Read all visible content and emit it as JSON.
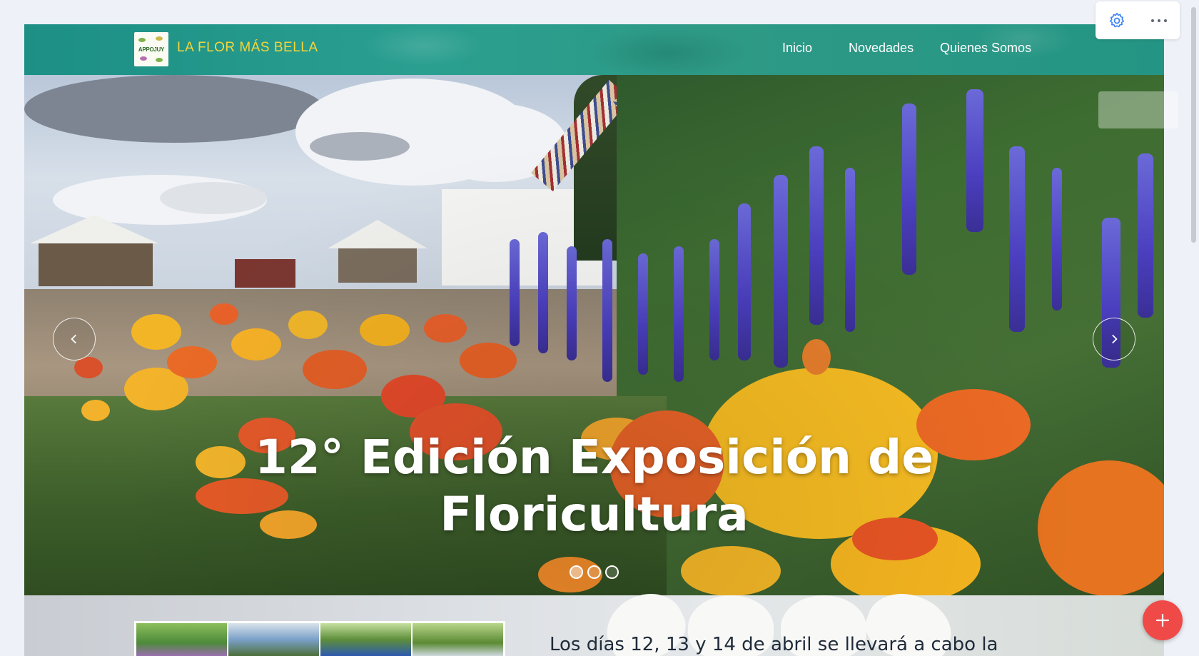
{
  "navbar": {
    "brand_logo_text": "APPOJUY",
    "brand_name": "LA FLOR MÁS BELLA",
    "links": [
      {
        "label": "Inicio"
      },
      {
        "label": "Novedades"
      },
      {
        "label": "Quienes Somos"
      }
    ]
  },
  "hero": {
    "title_line1": "12° Edición Exposición de",
    "title_line2": "Floricultura",
    "prev_icon": "chevron-left-icon",
    "next_icon": "chevron-right-icon",
    "slide_count": 3,
    "active_slide": 1
  },
  "intro": {
    "text": "Los días 12, 13 y 14 de abril se llevará a cabo la"
  },
  "controls": {
    "settings_icon": "gear-icon",
    "more_icon": "more-horizontal-icon",
    "fab_icon": "plus-icon"
  },
  "colors": {
    "navbar": "#249584",
    "brand_text": "#f5d53a",
    "fab": "#ef4a48",
    "settings_icon": "#3b82f6"
  }
}
